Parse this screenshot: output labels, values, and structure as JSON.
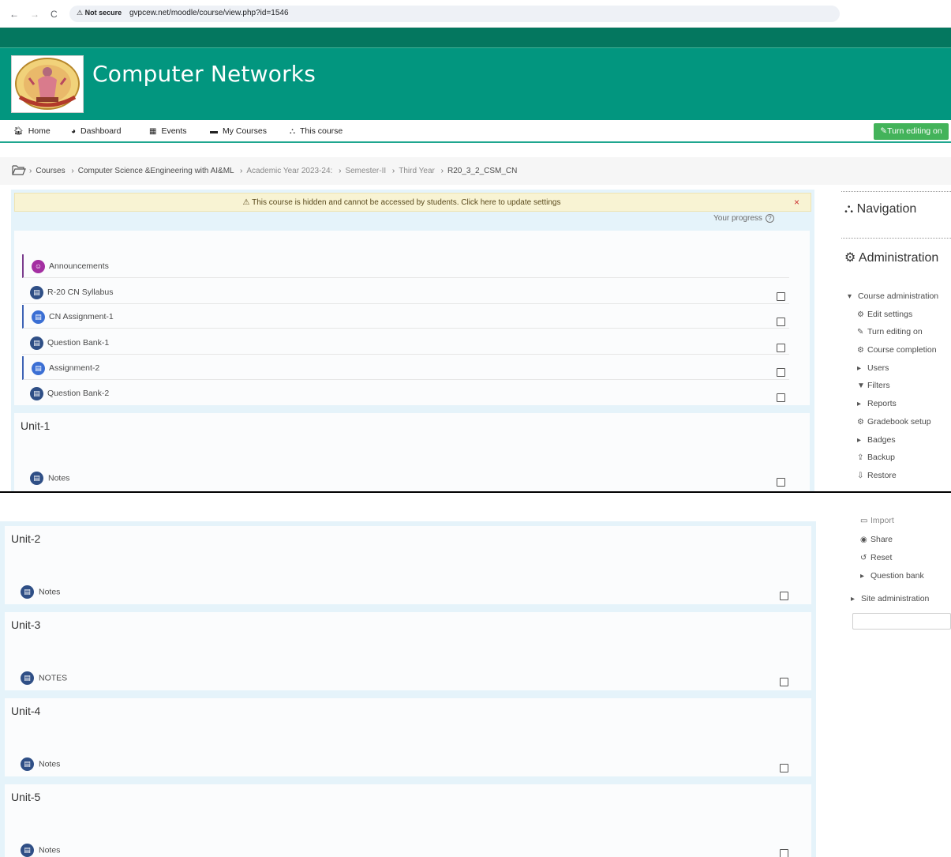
{
  "browser": {
    "back_icon": "arrow-left-icon",
    "forward_icon": "arrow-right-icon",
    "reload_icon": "reload-icon",
    "security_label": "⚠ Not secure",
    "url": "gvpcew.net/moodle/course/view.php?id=1546"
  },
  "header": {
    "course_name": "Computer Networks",
    "logo_text": "GAYATRI VIDYA PARISHAD"
  },
  "nav": {
    "home": "Home",
    "dashboard": "Dashboard",
    "events": "Events",
    "my_courses": "My Courses",
    "this_course": "This course",
    "edit_button": "Turn editing on"
  },
  "breadcrumb": {
    "items": [
      "Courses",
      "Computer Science &Engineering with AI&ML",
      "Academic Year 2023-24:",
      "Semester-II",
      "Third Year",
      "R20_3_2_CSM_CN"
    ]
  },
  "alert": {
    "text": "This course is hidden and cannot be accessed by students. Click here to update settings",
    "close": "×"
  },
  "progress_label": "Your progress",
  "general_activities": [
    {
      "label": "Announcements"
    },
    {
      "label": "R-20 CN Syllabus"
    },
    {
      "label": "CN Assignment-1"
    },
    {
      "label": "Question Bank-1"
    },
    {
      "label": "Assignment-2"
    },
    {
      "label": "Question Bank-2"
    }
  ],
  "sections": [
    {
      "title": "Unit-1",
      "activity": "Notes"
    },
    {
      "title": "Unit-2",
      "activity": "Notes"
    },
    {
      "title": "Unit-3",
      "activity": "NOTES"
    },
    {
      "title": "Unit-4",
      "activity": "Notes"
    },
    {
      "title": "Unit-5",
      "activity": "Notes"
    }
  ],
  "sidebar": {
    "navigation_title": "Navigation",
    "administration_title": "Administration",
    "course_admin": "Course administration",
    "items": [
      "Edit settings",
      "Turn editing on",
      "Course completion",
      "Users",
      "Filters",
      "Reports",
      "Gradebook setup",
      "Badges",
      "Backup",
      "Restore"
    ],
    "items_lower": [
      "Import",
      "Share",
      "Reset",
      "Question bank"
    ],
    "site_admin": "Site administration"
  }
}
